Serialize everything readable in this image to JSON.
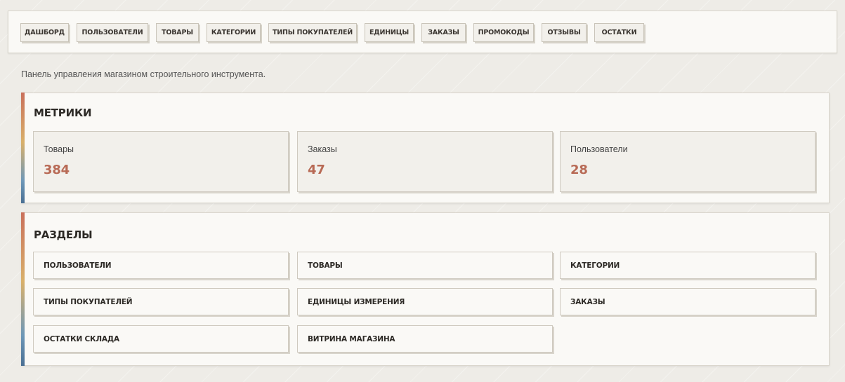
{
  "nav": {
    "items": [
      {
        "label": "ДАШБОРД"
      },
      {
        "label": "ПОЛЬЗОВАТЕЛИ"
      },
      {
        "label": "ТОВАРЫ"
      },
      {
        "label": "КАТЕГОРИИ"
      },
      {
        "label": "ТИПЫ ПОКУПАТЕЛЕЙ"
      },
      {
        "label": "ЕДИНИЦЫ"
      },
      {
        "label": "ЗАКАЗЫ"
      },
      {
        "label": "ПРОМОКОДЫ"
      },
      {
        "label": "ОТЗЫВЫ"
      },
      {
        "label": "ОСТАТКИ"
      }
    ]
  },
  "intro": "Панель управления магазином строительного инструмента.",
  "metrics": {
    "title": "МЕТРИКИ",
    "items": [
      {
        "label": "Товары",
        "value": "384"
      },
      {
        "label": "Заказы",
        "value": "47"
      },
      {
        "label": "Пользователи",
        "value": "28"
      }
    ]
  },
  "sections": {
    "title": "РАЗДЕЛЫ",
    "items": [
      {
        "label": "ПОЛЬЗОВАТЕЛИ"
      },
      {
        "label": "ТОВАРЫ"
      },
      {
        "label": "КАТЕГОРИИ"
      },
      {
        "label": "ТИПЫ ПОКУПАТЕЛЕЙ"
      },
      {
        "label": "ЕДИНИЦЫ ИЗМЕРЕНИЯ"
      },
      {
        "label": "ЗАКАЗЫ"
      },
      {
        "label": "ОСТАТКИ СКЛАДА"
      },
      {
        "label": "ВИТРИНА МАГАЗИНА"
      }
    ]
  },
  "colors": {
    "accent": "#b86a55",
    "background": "#eeece7",
    "panel": "#faf9f6"
  }
}
